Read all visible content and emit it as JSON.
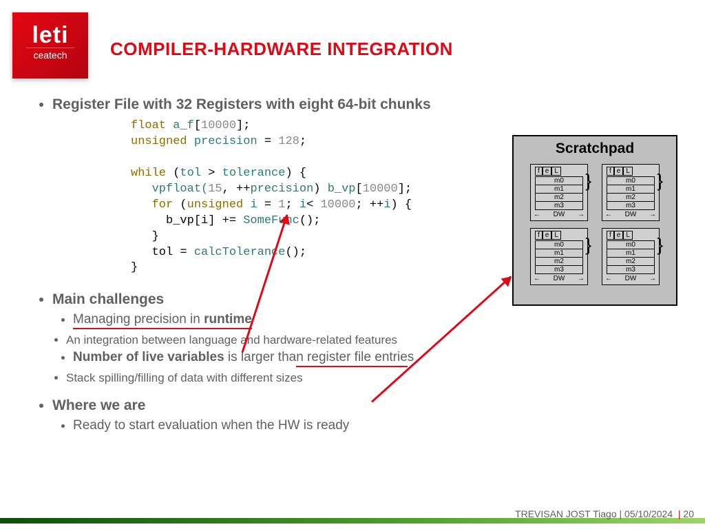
{
  "logo": {
    "main": "leti",
    "sub": "ceatech"
  },
  "title": "COMPILER-HARDWARE INTEGRATION",
  "bullets": {
    "register_file": "Register File with 32 Registers with eight 64-bit chunks",
    "main_challenges": "Main challenges",
    "mc_runtime_prefix": "Managing precision in ",
    "mc_runtime_bold": "runtime",
    "mc_runtime_sub": "An integration between language and hardware-related features",
    "mc_live_bold": "Number of live variables",
    "mc_live_rest_a": " is larger tha",
    "mc_live_rest_b": "n register file entrie",
    "mc_live_rest_c": "s",
    "mc_live_sub": "Stack spilling/filling of data with different sizes",
    "where_we_are": "Where we are",
    "where_sub": "Ready to start evaluation when the HW is ready"
  },
  "code": {
    "kw_float": "float",
    "id_af": "a_f",
    "arr1": "[",
    "num_10000": "10000",
    "arr2": "];",
    "kw_unsigned": "unsigned",
    "id_prec": "precision",
    "eq": " = ",
    "num_128": "128",
    "semi": ";",
    "kw_while": "while",
    "paren_open": " (",
    "id_tol": "tol",
    "gt": " > ",
    "id_tolerance": "tolerance",
    "paren_close_brace": ") {",
    "indent": "   ",
    "vpfloat": "vpfloat(",
    "num_15": "15",
    "comma_pp": ", ++",
    "paren_close": ") ",
    "id_bvp": "b_vp",
    "kw_for": "for",
    "for_open": " (",
    "kw_unsigned2": "unsigned",
    "id_i": "i",
    "eq1": " = ",
    "num_1": "1",
    "semi_sp": "; ",
    "id_i2": "i",
    "lt": "< ",
    "num_10000b": "10000",
    "semi_pp": "; ++",
    "id_i3": "i",
    "paren_close_brace2": ") {",
    "indent2": "     ",
    "bvp_i": "b_vp[i] += ",
    "id_somefunc": "SomeFunc",
    "call": "();",
    "brace_close": "   }",
    "tol_assign": "   tol = ",
    "id_calctol": "calcTolerance",
    "brace_close2": "}"
  },
  "scratchpad": {
    "title": "Scratchpad",
    "hdr_f": "f",
    "hdr_e": "e",
    "hdr_L": "L",
    "m0": "m0",
    "m1": "m1",
    "m2": "m2",
    "m3": "m3",
    "dw": "DW"
  },
  "footer": {
    "author": "TREVISAN JOST Tiago",
    "date": "05/10/2024",
    "page": "20",
    "sep": " | "
  }
}
